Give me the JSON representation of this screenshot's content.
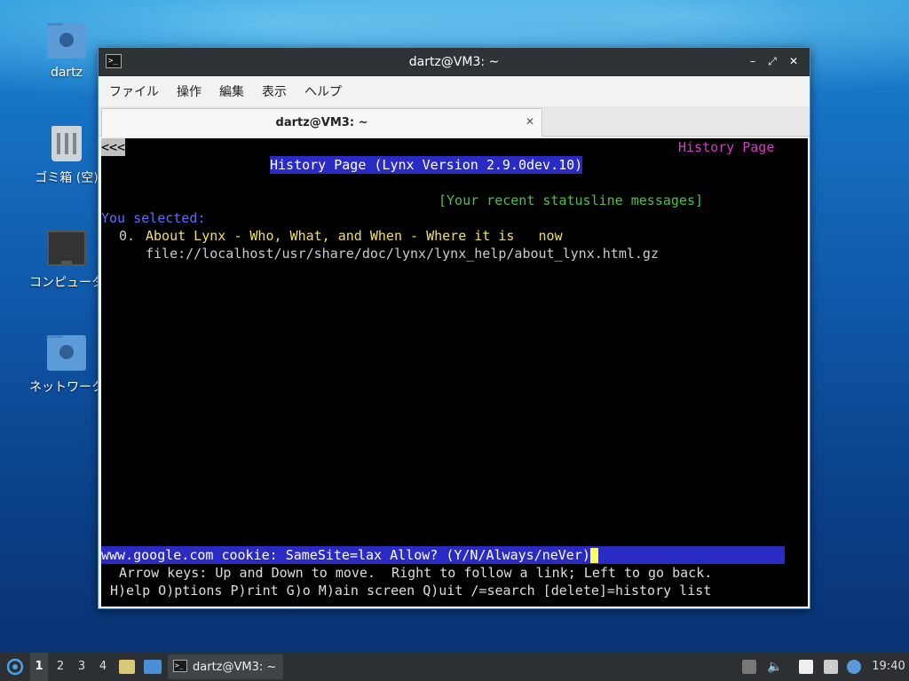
{
  "desktop": {
    "icons": [
      {
        "label": "dartz",
        "icon": "home-folder-icon"
      },
      {
        "label": "ゴミ箱 (空)",
        "icon": "trash-icon"
      },
      {
        "label": "コンピュータ",
        "icon": "computer-icon"
      },
      {
        "label": "ネットワーク",
        "icon": "network-folder-icon"
      }
    ]
  },
  "window": {
    "title": "dartz@VM3: ~",
    "controls": {
      "minimize": "–",
      "maximize": "⤢",
      "close": "✕"
    },
    "menu": [
      "ファイル",
      "操作",
      "編集",
      "表示",
      "ヘルプ"
    ],
    "tab": {
      "label": "dartz@VM3: ~",
      "close": "✕"
    }
  },
  "terminal": {
    "back": "<<<",
    "page_label": "History Page",
    "heading": "History Page (Lynx Version 2.9.0dev.10)",
    "statusline_link": "[Your recent statusline messages]",
    "you_selected": "You selected:",
    "item_number": "0.",
    "item_title": "About Lynx - Who, What, and When - Where it is   now",
    "item_url": "file://localhost/usr/share/doc/lynx/lynx_help/about_lynx.html.gz",
    "prompt": "www.google.com cookie: SameSite=lax Allow? (Y/N/Always/neVer)",
    "help_line1": "Arrow keys: Up and Down to move.  Right to follow a link; Left to go back.",
    "help_line2": "H)elp O)ptions P)rint G)o M)ain screen Q)uit /=search [delete]=history list"
  },
  "taskbar": {
    "workspaces": [
      "1",
      "2",
      "3",
      "4"
    ],
    "active_workspace": "1",
    "task_label": "dartz@VM3: ~",
    "clock": "19:40"
  }
}
